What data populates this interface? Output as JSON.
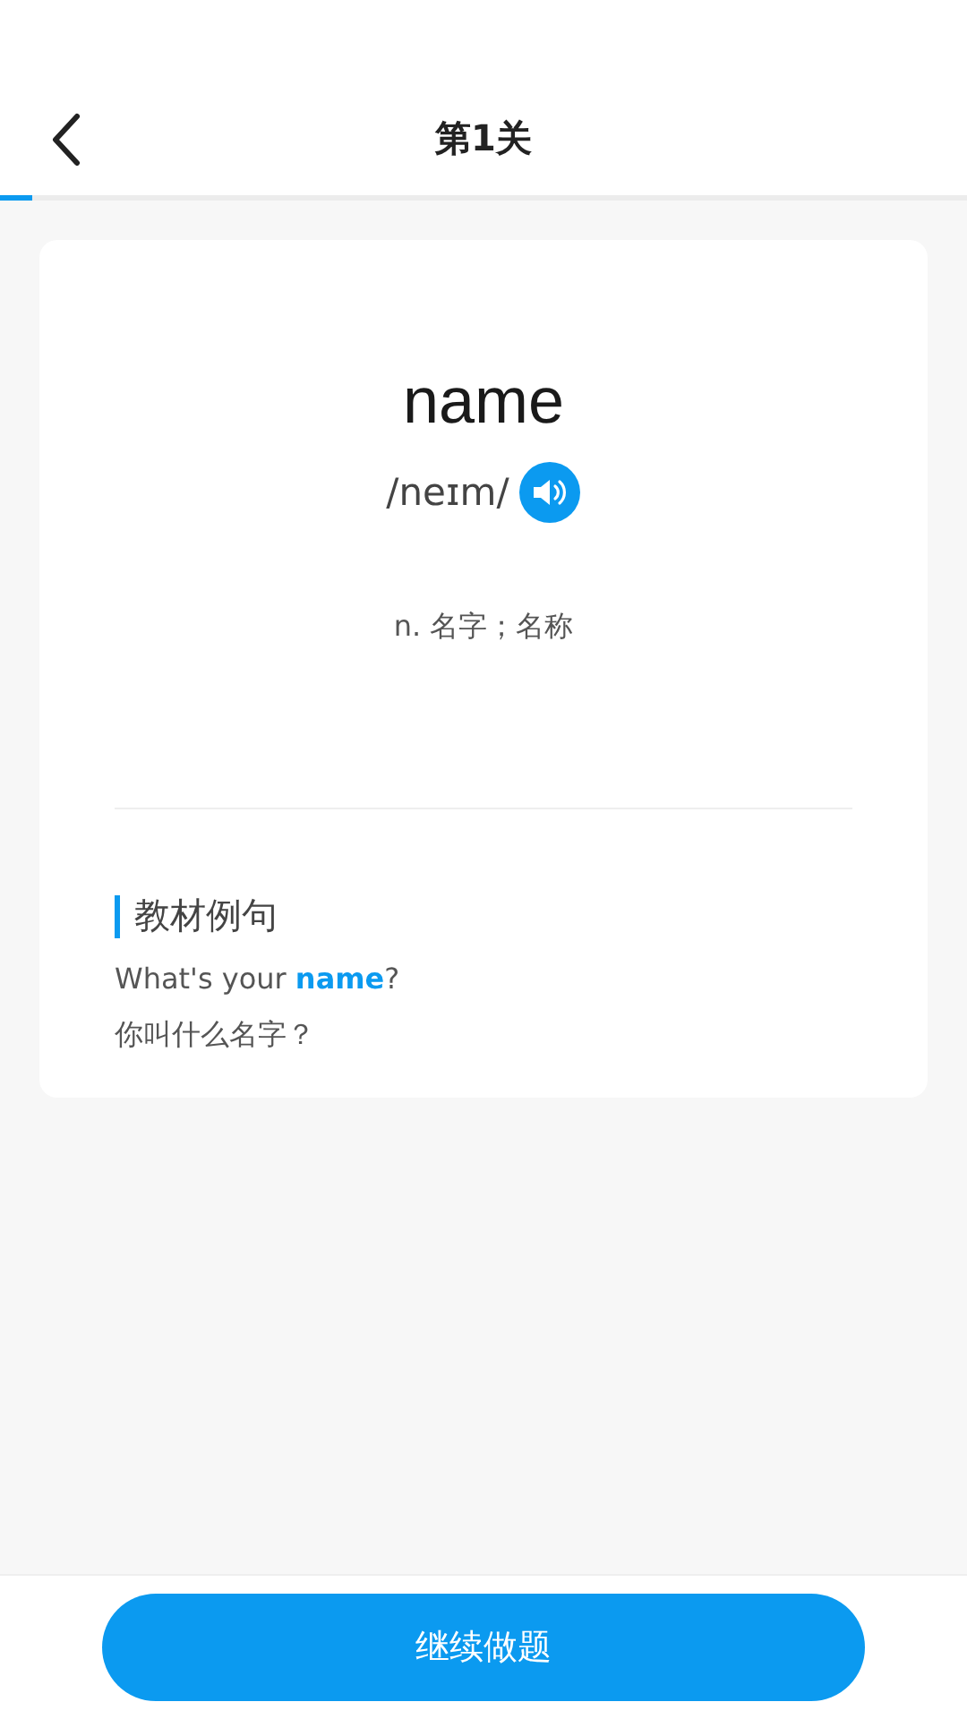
{
  "header": {
    "title": "第1关"
  },
  "progress": {
    "level": 0.034
  },
  "word": {
    "text": "name",
    "phonetic": "/neɪm/",
    "definition": "n. 名字；名称"
  },
  "examples": {
    "heading": "教材例句",
    "sentences": [
      {
        "text": "What's your **name**?"
      },
      {
        "text": "你叫什么名字？"
      }
    ]
  },
  "button": {
    "label": "继续做题"
  }
}
